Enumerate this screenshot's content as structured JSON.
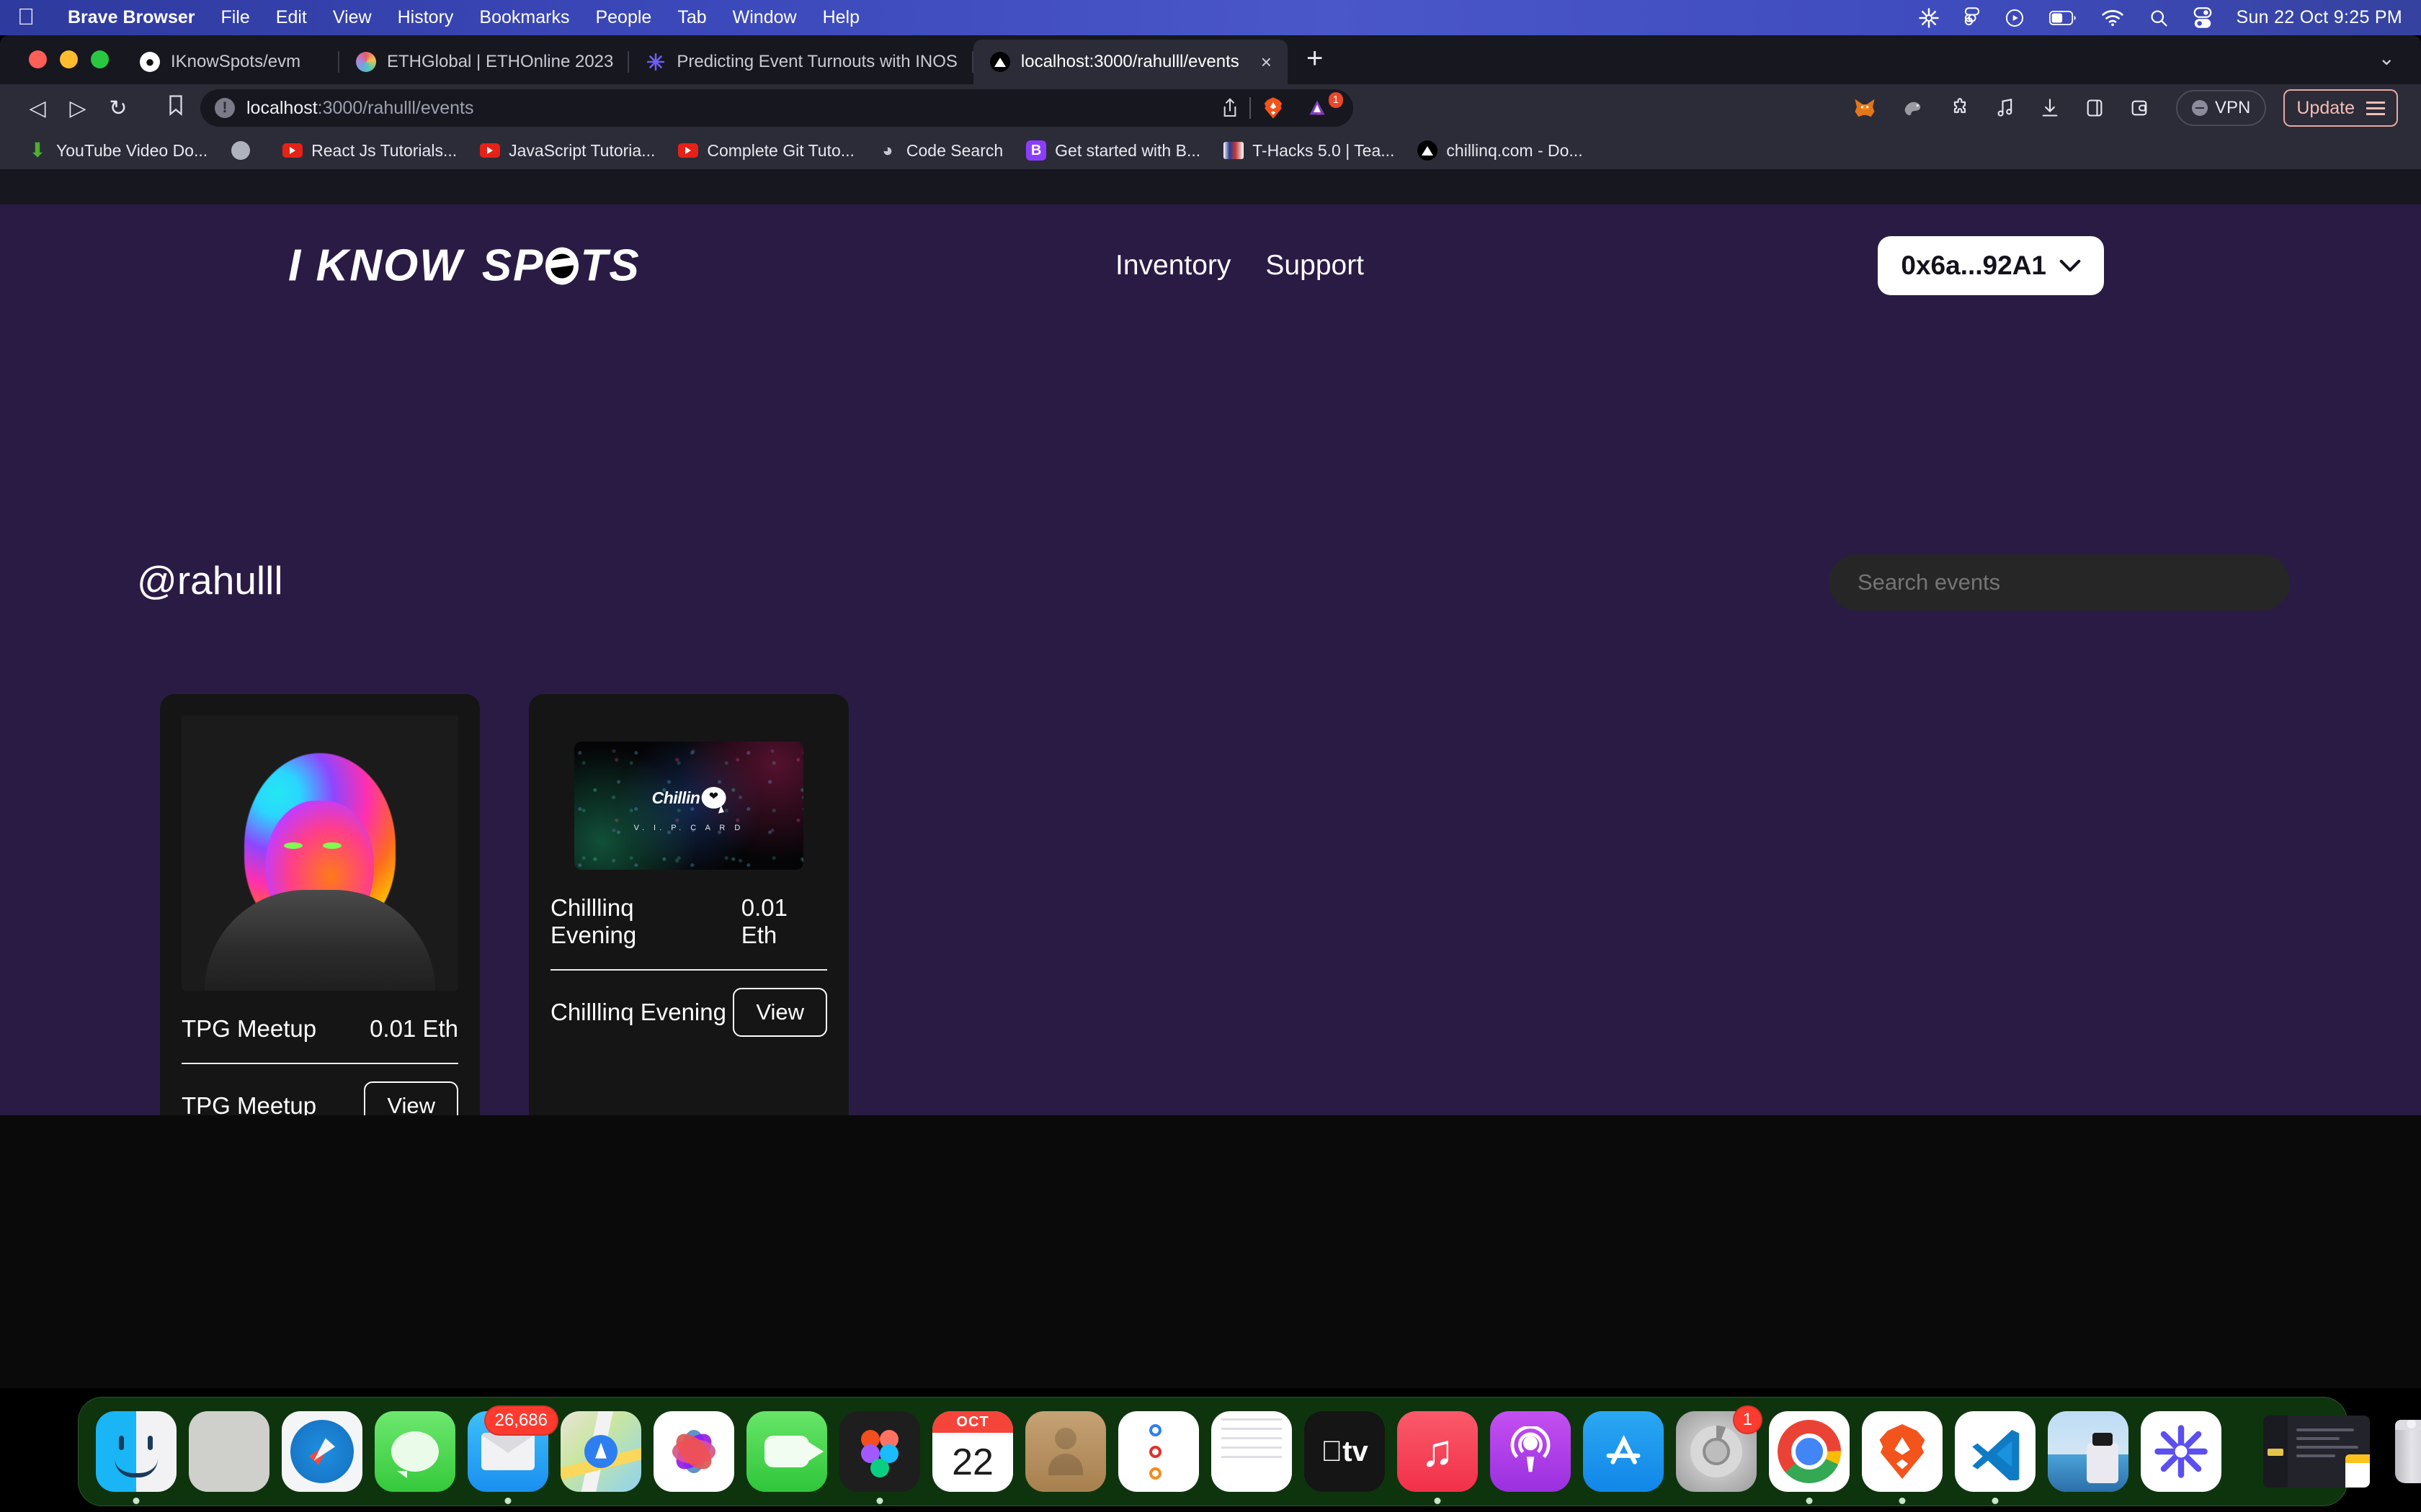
{
  "menubar": {
    "apple_glyph": "",
    "app_name": "Brave Browser",
    "items": [
      "File",
      "Edit",
      "View",
      "History",
      "Bookmarks",
      "People",
      "Tab",
      "Window",
      "Help"
    ],
    "status_icons": [
      "warp-asterisk-icon",
      "figma-icon",
      "play-circle-icon",
      "battery-icon",
      "wifi-icon",
      "search-icon",
      "control-center-icon"
    ],
    "clock": "Sun 22 Oct  9:25 PM"
  },
  "browser": {
    "tabs": [
      {
        "title": "IKnowSpots/evm",
        "favicon": "github-icon",
        "active": false
      },
      {
        "title": "ETHGlobal | ETHOnline 2023",
        "favicon": "ethglobal-icon",
        "active": false
      },
      {
        "title": "Predicting Event Turnouts with INOS",
        "favicon": "warp-asterisk-icon",
        "active": false
      },
      {
        "title": "localhost:3000/rahulll/events",
        "favicon": "vercel-triangle-icon",
        "active": true
      }
    ],
    "new_tab_label": "+",
    "tab_close_label": "×",
    "tab_list_chevron": "⌄",
    "nav": {
      "back": "◁",
      "forward": "▷",
      "reload": "↻",
      "bookmark": "🔖"
    },
    "url": {
      "host": "localhost",
      "path": ":3000/rahulll/events",
      "full": "localhost:3000/rahulll/events"
    },
    "url_actions": [
      "share-icon",
      "brave-lion-icon",
      "brave-rewards-icon"
    ],
    "shield_badge_count": "1",
    "extensions": [
      "metamask-fox-icon",
      "rabby-wallet-icon",
      "puzzle-extension-icon",
      "music-note-icon",
      "download-icon",
      "sidebar-icon",
      "wallet-icon"
    ],
    "vpn_label": "VPN",
    "update_label": "Update",
    "bookmarks": [
      {
        "label": "YouTube Video Do...",
        "icon": "download-arrow-icon"
      },
      {
        "label": "",
        "icon": "globe-icon"
      },
      {
        "label": "React Js Tutorials...",
        "icon": "youtube-icon"
      },
      {
        "label": "JavaScript Tutoria...",
        "icon": "youtube-icon"
      },
      {
        "label": "Complete Git Tuto...",
        "icon": "youtube-icon"
      },
      {
        "label": "Code Search",
        "icon": "dots-grid-icon"
      },
      {
        "label": "Get started with B...",
        "icon": "b-square-icon"
      },
      {
        "label": "T-Hacks 5.0 | Tea...",
        "icon": "thacks-icon"
      },
      {
        "label": "chillinq.com - Do...",
        "icon": "vercel-triangle-icon"
      }
    ]
  },
  "site": {
    "logo": {
      "part1": "I KNOW",
      "part2_prefix": "SP",
      "part2_suffix": "TS"
    },
    "nav_links": [
      "Inventory",
      "Support"
    ],
    "wallet": {
      "address": "0x6a...92A1",
      "chevron": "⌄"
    },
    "username": "@rahulll",
    "search": {
      "placeholder": "Search events",
      "value": ""
    },
    "cards": [
      {
        "image": "nft-rainbow-head-art",
        "title": "TPG Meetup",
        "price": "0.01 Eth",
        "subtitle": "TPG Meetup",
        "action_label": "View"
      },
      {
        "image": "chillinq-vip-card-art",
        "image_brand": "Chillin",
        "image_sub": "V. I. P.   C A R D",
        "title": "Chilllinq Evening",
        "price": "0.01 Eth",
        "subtitle": "Chilllinq Evening",
        "action_label": "View"
      }
    ],
    "colors": {
      "background": "#2a1b45",
      "card_background": "#151515",
      "bottom_band": "#0a0a0a",
      "accent": "#ffffff"
    }
  },
  "dock": {
    "items": [
      {
        "name": "finder",
        "badge": "",
        "running": true
      },
      {
        "name": "launchpad",
        "badge": "",
        "running": false
      },
      {
        "name": "safari",
        "badge": "",
        "running": false
      },
      {
        "name": "messages",
        "badge": "",
        "running": false
      },
      {
        "name": "mail",
        "badge": "26,686",
        "running": true
      },
      {
        "name": "maps",
        "badge": "",
        "running": false
      },
      {
        "name": "photos",
        "badge": "",
        "running": false
      },
      {
        "name": "facetime",
        "badge": "",
        "running": false
      },
      {
        "name": "figma",
        "badge": "",
        "running": true
      },
      {
        "name": "calendar",
        "badge": "",
        "running": false,
        "month": "OCT",
        "day": "22"
      },
      {
        "name": "contacts",
        "badge": "",
        "running": false
      },
      {
        "name": "reminders",
        "badge": "",
        "running": false
      },
      {
        "name": "notes",
        "badge": "",
        "running": true
      },
      {
        "name": "apple-tv",
        "badge": "",
        "running": false,
        "label": "tv"
      },
      {
        "name": "music",
        "badge": "",
        "running": true
      },
      {
        "name": "podcasts",
        "badge": "",
        "running": false
      },
      {
        "name": "app-store",
        "badge": "",
        "running": false
      },
      {
        "name": "system-settings",
        "badge": "1",
        "running": false
      },
      {
        "name": "google-chrome",
        "badge": "",
        "running": true
      },
      {
        "name": "brave-browser",
        "badge": "",
        "running": true
      },
      {
        "name": "visual-studio-code",
        "badge": "",
        "running": true
      },
      {
        "name": "preview",
        "badge": "",
        "running": false
      },
      {
        "name": "warp-terminal",
        "badge": "",
        "running": false
      },
      {
        "name": "minimized-window",
        "badge": "",
        "running": false
      },
      {
        "name": "trash",
        "badge": "",
        "running": false
      }
    ]
  }
}
